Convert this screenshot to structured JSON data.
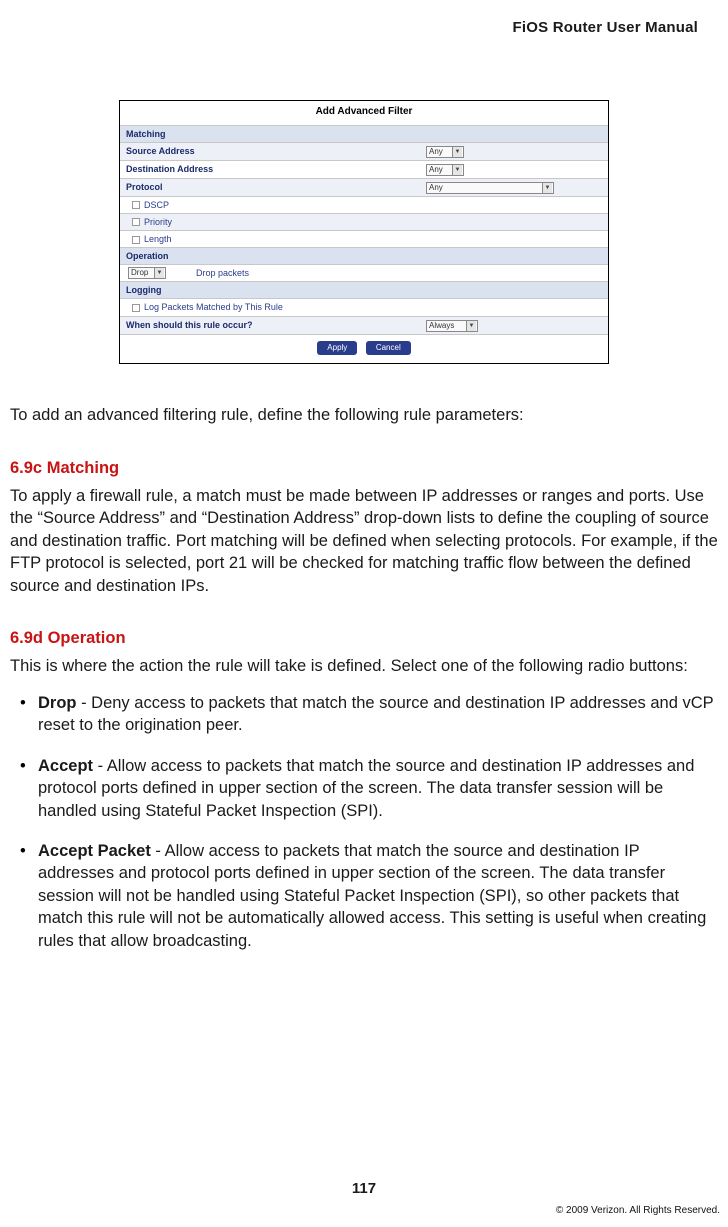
{
  "header": {
    "title": "FiOS Router User Manual"
  },
  "figure": {
    "title": "Add Advanced Filter",
    "rows": {
      "matching": "Matching",
      "source_addr": "Source Address",
      "dest_addr": "Destination Address",
      "protocol": "Protocol",
      "dscp": "DSCP",
      "priority": "Priority",
      "length": "Length",
      "operation": "Operation",
      "drop_packets": "Drop packets",
      "logging": "Logging",
      "log_rule": "Log Packets Matched by This Rule",
      "when": "When should this rule occur?"
    },
    "dd": {
      "any": "Any",
      "drop": "Drop",
      "always": "Always"
    },
    "buttons": {
      "apply": "Apply",
      "cancel": "Cancel"
    }
  },
  "intro": "To add an advanced filtering rule, define the following rule parameters:",
  "sections": {
    "matching": {
      "heading": "6.9c  Matching",
      "body": "To apply a firewall rule, a match must be made between IP addresses or ranges and ports. Use the “Source Address” and “Destination Address” drop-down lists to define the coupling of source and destination traffic. Port matching will be defined when selecting protocols. For example, if the FTP protocol is selected, port 21 will be checked for matching traffic flow between the defined source and destination IPs."
    },
    "operation": {
      "heading": "6.9d  Operation",
      "body": "This is where the action the rule will take is defined. Select one of the following radio buttons:",
      "items": [
        {
          "term": "Drop",
          "desc": " - Deny access to packets that match the source and destination IP addresses and vCP reset to the origination peer."
        },
        {
          "term": "Accept",
          "desc": " - Allow access to packets that match the source and destination IP addresses and protocol ports defined in upper section of the screen. The data transfer session will be handled using Stateful Packet Inspection (SPI)."
        },
        {
          "term": "Accept Packet",
          "desc": " - Allow access to packets that match the source and destination IP addresses and protocol ports defined in upper section of the screen. The data transfer session will not be handled using Stateful Packet Inspection (SPI), so other packets that match this rule will not be automatically allowed access. This setting is useful when creating rules that allow broadcasting."
        }
      ]
    }
  },
  "footer": {
    "page_num": "117",
    "copyright": "© 2009 Verizon. All Rights Reserved."
  }
}
